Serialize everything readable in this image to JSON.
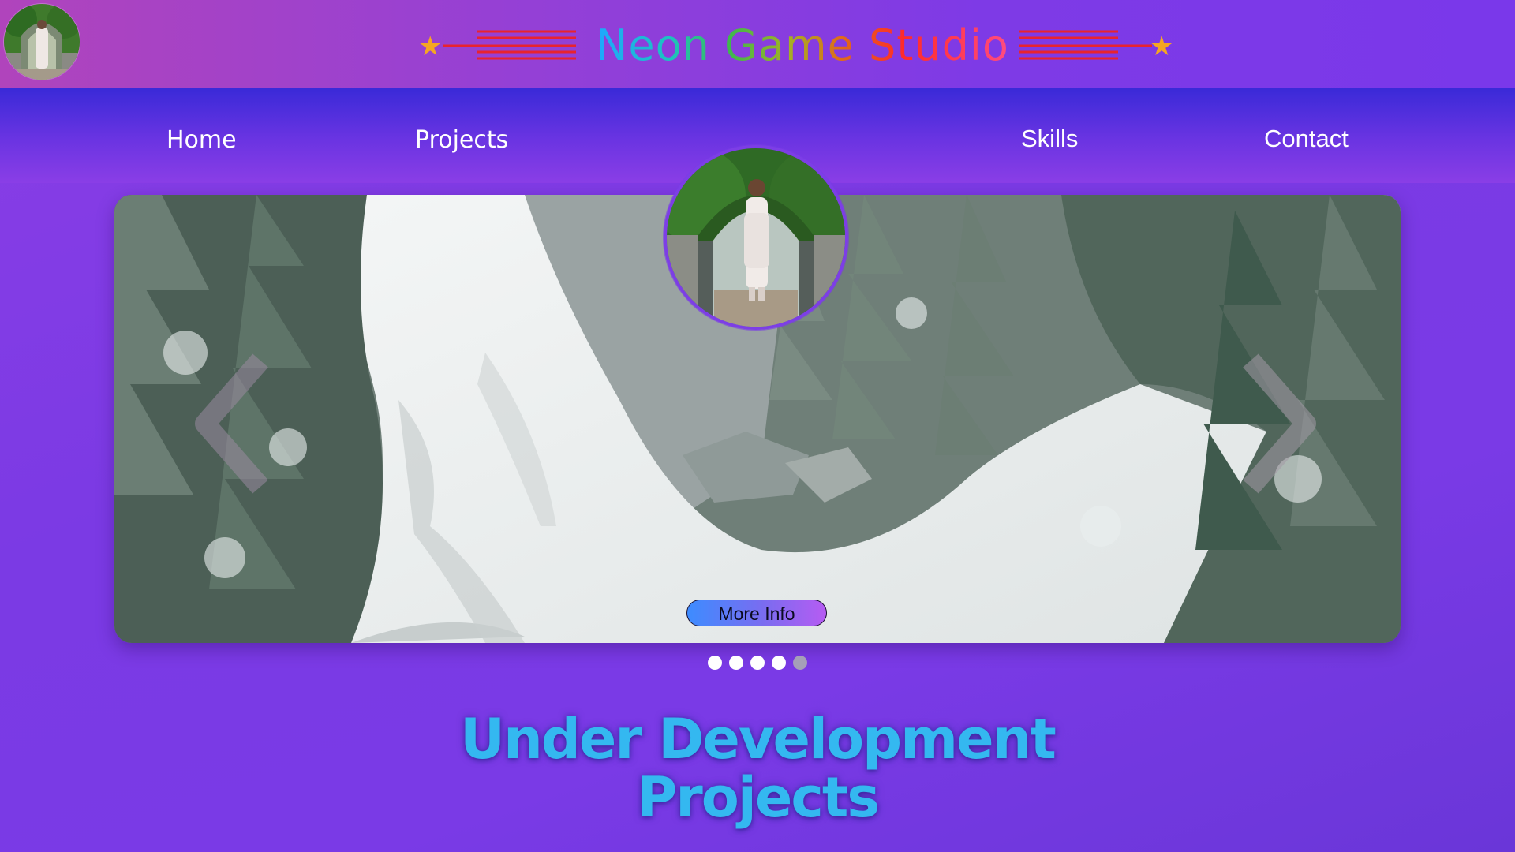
{
  "header": {
    "title": "Neon Game Studio",
    "decor_star": "★",
    "accent_red": "#e8232f",
    "accent_gold": "#f5a623"
  },
  "nav": {
    "items": [
      {
        "label": "Home"
      },
      {
        "label": "Projects"
      },
      {
        "label": "Skills"
      },
      {
        "label": "Contact"
      }
    ]
  },
  "carousel": {
    "button_label": "More Info",
    "slide_count": 5,
    "active_slide": 5,
    "prev_icon": "chevron-left-icon",
    "next_icon": "chevron-right-icon"
  },
  "section": {
    "heading_line1": "Under Development",
    "heading_line2": "Projects",
    "heading_color": "#34b8f0"
  }
}
